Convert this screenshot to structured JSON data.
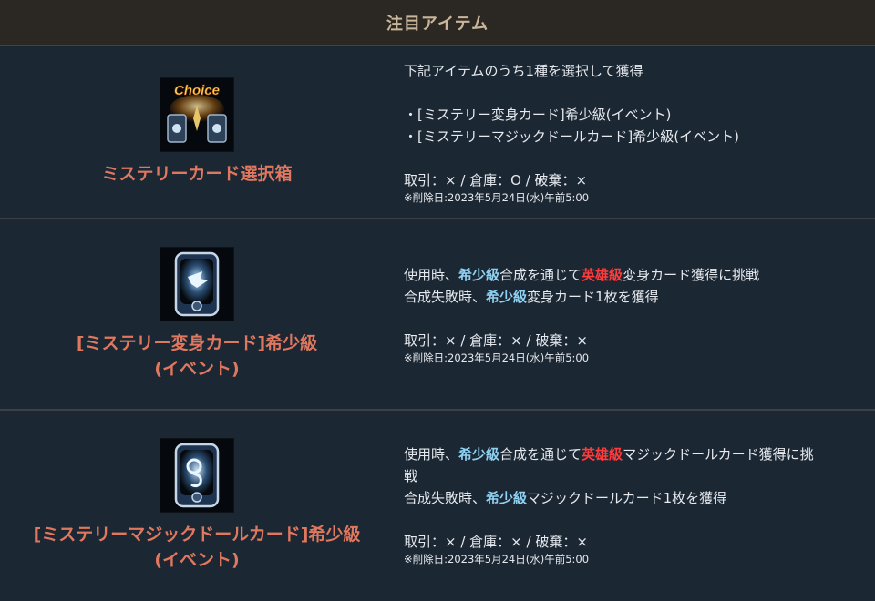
{
  "header": {
    "title": "注目アイテム"
  },
  "items": [
    {
      "icon": "choice-box-icon",
      "name_lines": [
        "ミステリーカード選択箱"
      ],
      "choice_label": "Choice",
      "desc_intro": "下記アイテムのうち1種を選択して獲得",
      "options": [
        "・[ミステリー変身カード]希少級(イベント)",
        "・[ミステリーマジックドールカード]希少級(イベント)"
      ],
      "trade": "取引：× / 倉庫：O / 破棄：×",
      "deletion": "※削除日:2023年5月24日(水)午前5:00"
    },
    {
      "icon": "mystery-transform-card-icon",
      "name_lines": [
        "[ミステリー変身カード]希少級",
        "(イベント)"
      ],
      "desc": {
        "l1_a": "使用時、",
        "l1_b": "希少級",
        "l1_c": "合成を通じて",
        "l1_d": "英雄級",
        "l1_e": "変身カード獲得に挑戦",
        "l2_a": "合成失敗時、",
        "l2_b": "希少級",
        "l2_c": "変身カード1枚を獲得"
      },
      "trade": "取引：× / 倉庫：× / 破棄：×",
      "deletion": "※削除日:2023年5月24日(水)午前5:00"
    },
    {
      "icon": "mystery-magic-doll-card-icon",
      "name_lines": [
        "[ミステリーマジックドールカード]希少級",
        "(イベント)"
      ],
      "desc": {
        "l1_a": "使用時、",
        "l1_b": "希少級",
        "l1_c": "合成を通じて",
        "l1_d": "英雄級",
        "l1_e": "マジックドールカード獲得に挑",
        "l1_f": "戦",
        "l2_a": "合成失敗時、",
        "l2_b": "希少級",
        "l2_c": "マジックドールカード1枚を獲得"
      },
      "trade": "取引：× / 倉庫：× / 破棄：×",
      "deletion": "※削除日:2023年5月24日(水)午前5:00"
    }
  ],
  "colors": {
    "name": "#e0775f",
    "rare": "#8fd1f2",
    "hero": "#ff3b3b",
    "header_text": "#c8b59a"
  }
}
